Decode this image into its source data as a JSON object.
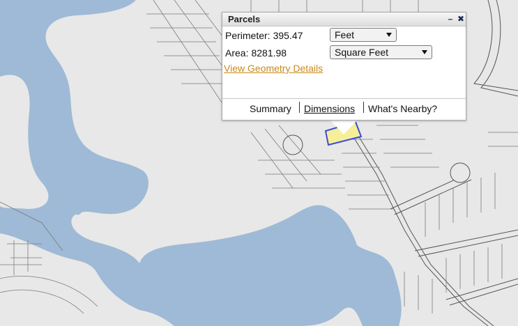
{
  "popup": {
    "title": "Parcels",
    "minimize_icon": "minimize-icon",
    "close_icon": "close-icon",
    "perimeter": {
      "label": "Perimeter:",
      "value": "395.47",
      "unit": "Feet"
    },
    "area": {
      "label": "Area:",
      "value": "8281.98",
      "unit": "Square Feet"
    },
    "geometry_link": "View Geometry Details",
    "tabs": [
      {
        "label": "Summary"
      },
      {
        "label": "Dimensions"
      },
      {
        "label": "What's Nearby?"
      }
    ]
  },
  "colors": {
    "water": "#9fbad6",
    "land": "#e8e8e8",
    "parcel_line": "#7a7a7a",
    "highlight_fill": "#f5ef9a",
    "highlight_border": "#3d4bd6",
    "link": "#c98a1a"
  }
}
